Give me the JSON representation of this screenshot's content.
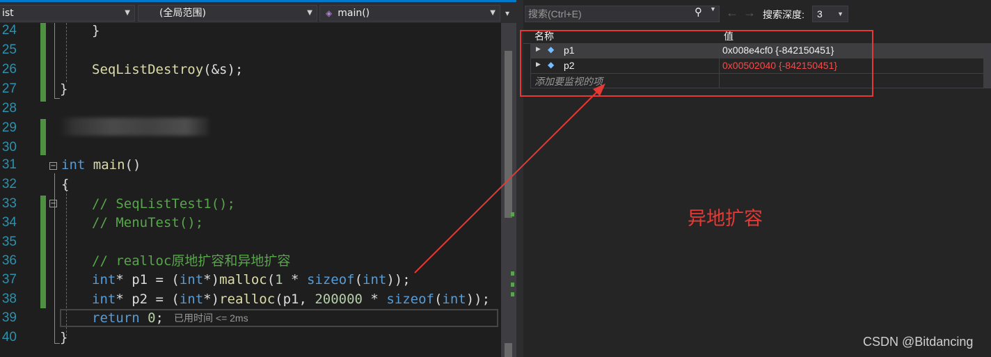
{
  "nav": {
    "file": "ist",
    "scope": "(全局范围)",
    "function": "main()"
  },
  "code": {
    "lines": {
      "l24": {
        "num": "24",
        "text": "}"
      },
      "l25": {
        "num": "25"
      },
      "l26": {
        "num": "26",
        "fn": "SeqListDestroy",
        "rest": "(&s);"
      },
      "l27": {
        "num": "27",
        "text": "}"
      },
      "l28": {
        "num": "28"
      },
      "l29": {
        "num": "29"
      },
      "l30": {
        "num": "30"
      },
      "l31": {
        "num": "31",
        "kw": "int",
        "fn": "main",
        "rest": "()"
      },
      "l32": {
        "num": "32",
        "text": "{"
      },
      "l33": {
        "num": "33",
        "comment": "// SeqListTest1();"
      },
      "l34": {
        "num": "34",
        "comment": "// MenuTest();"
      },
      "l35": {
        "num": "35"
      },
      "l36": {
        "num": "36",
        "comment": "// realloc原地扩容和异地扩容"
      },
      "l37": {
        "num": "37",
        "t1": "int",
        "t2": "* p1 = (",
        "t3": "int",
        "t4": "*)",
        "t5": "malloc",
        "t6": "(",
        "t7": "1",
        "t8": " * ",
        "t9": "sizeof",
        "t10": "(",
        "t11": "int",
        "t12": "));"
      },
      "l38": {
        "num": "38",
        "t1": "int",
        "t2": "* p2 = (",
        "t3": "int",
        "t4": "*)",
        "t5": "realloc",
        "t6": "(p1, ",
        "t7": "200000",
        "t8": " * ",
        "t9": "sizeof",
        "t10": "(",
        "t11": "int",
        "t12": "));"
      },
      "l39": {
        "num": "39",
        "kw": "return",
        "num0": "0",
        "semi": ";",
        "perf": "已用时间 <= 2ms"
      },
      "l40": {
        "num": "40",
        "text": "}"
      }
    }
  },
  "watch": {
    "search_placeholder": "搜索(Ctrl+E)",
    "depth_label": "搜索深度:",
    "depth_value": "3",
    "col_name": "名称",
    "col_value": "值",
    "rows": [
      {
        "name": "p1",
        "value": "0x008e4cf0 {-842150451}",
        "value_color": "#f1f1f1"
      },
      {
        "name": "p2",
        "value": "0x00502040 {-842150451}",
        "value_color": "#f14c4c"
      }
    ],
    "add_item": "添加要监视的项"
  },
  "annotation": "异地扩容",
  "watermark": "CSDN @Bitdancing",
  "colors": {
    "annotation": "#e53935",
    "keyword": "#569cd6",
    "comment": "#57a64a",
    "accent": "#007acc"
  }
}
